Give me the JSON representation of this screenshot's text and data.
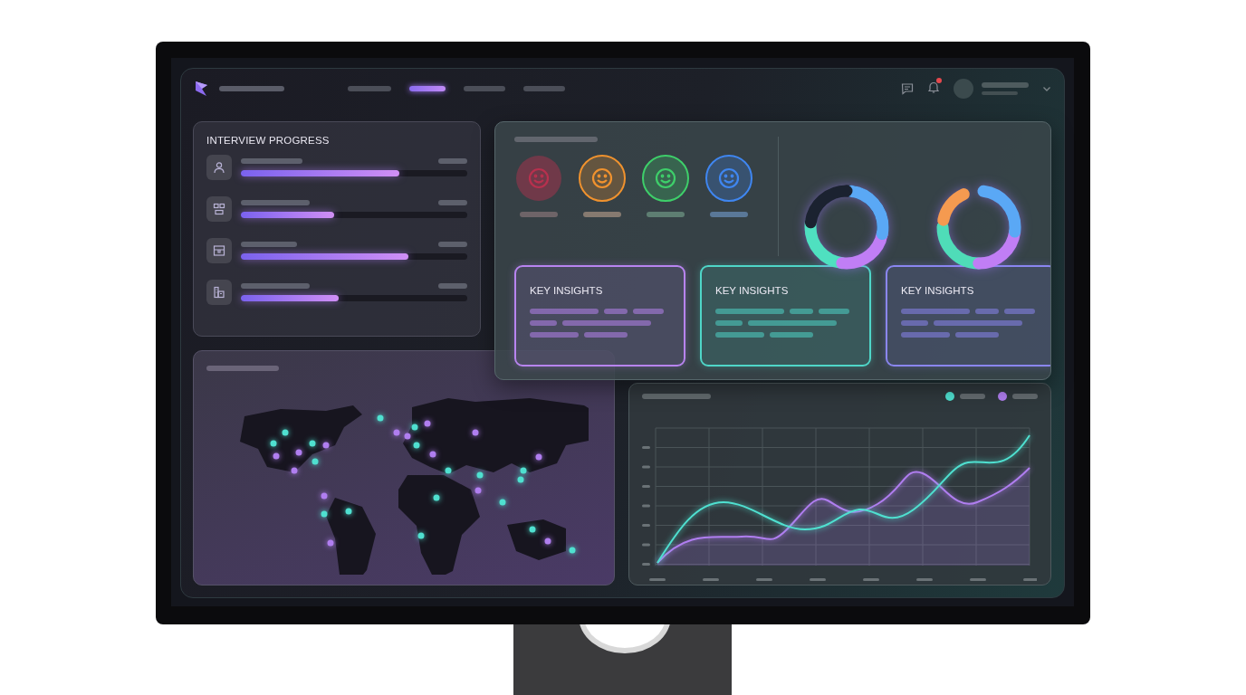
{
  "nav": [
    {
      "selected": false
    },
    {
      "selected": true
    },
    {
      "selected": false
    },
    {
      "selected": false
    }
  ],
  "notifications": {
    "unread": true
  },
  "interview_progress": {
    "title": "INTERVIEW PROGRESS",
    "items": [
      {
        "level": 0.7
      },
      {
        "level": 0.41
      },
      {
        "level": 0.74
      },
      {
        "level": 0.43
      }
    ]
  },
  "moods": [
    {
      "color": "#b8304e"
    },
    {
      "color": "#f0922e"
    },
    {
      "color": "#3ecf6a"
    },
    {
      "color": "#3f86f0"
    }
  ],
  "insights": [
    {
      "title": "KEY INSIGHTS",
      "color": "#b884f0"
    },
    {
      "title": "KEY INSIGHTS",
      "color": "#4fd6c8"
    },
    {
      "title": "KEY INSIGHTS",
      "color": "#8a86f0"
    }
  ],
  "chart": {
    "legend": [
      {
        "color": "#4fe0d0"
      },
      {
        "color": "#b07ef0"
      }
    ]
  }
}
